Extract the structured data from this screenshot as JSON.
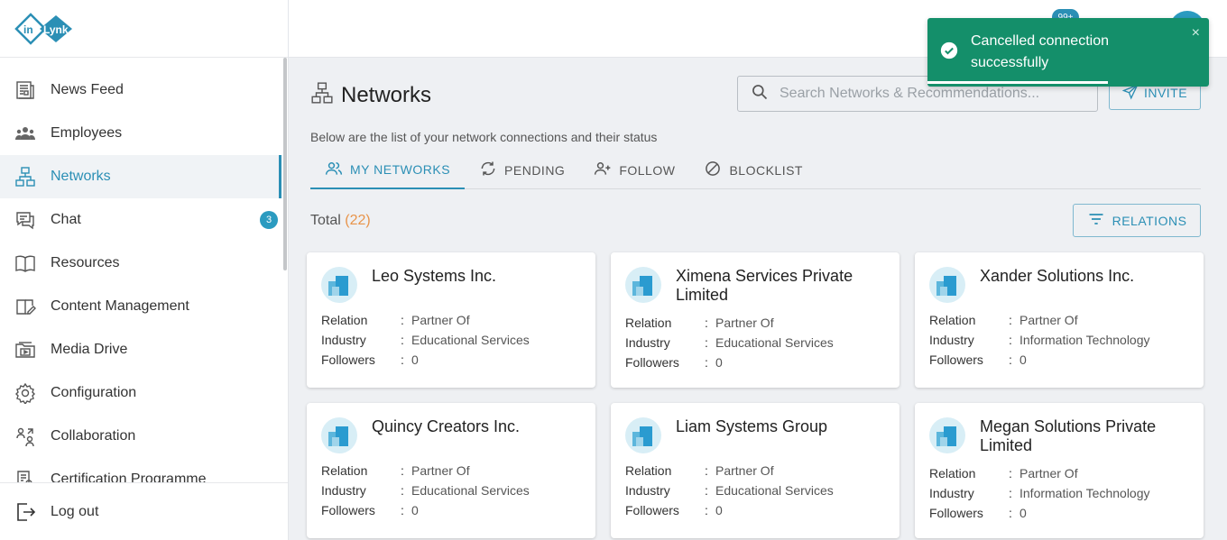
{
  "brand": {
    "logo_part1": "in",
    "logo_part2": "Lynk",
    "colors": {
      "accent": "#2b8fb5",
      "toast": "#148f6a",
      "count": "#e8944a"
    }
  },
  "sidebar": {
    "items": [
      {
        "label": "News Feed",
        "icon": "newspaper-icon"
      },
      {
        "label": "Employees",
        "icon": "people-icon"
      },
      {
        "label": "Networks",
        "icon": "network-icon",
        "active": true
      },
      {
        "label": "Chat",
        "icon": "chat-icon",
        "badge": "3"
      },
      {
        "label": "Resources",
        "icon": "book-icon"
      },
      {
        "label": "Content Management",
        "icon": "edit-book-icon"
      },
      {
        "label": "Media Drive",
        "icon": "folder-media-icon"
      },
      {
        "label": "Configuration",
        "icon": "gear-icon"
      },
      {
        "label": "Collaboration",
        "icon": "collaboration-icon"
      },
      {
        "label": "Certification Programme",
        "icon": "certificate-icon"
      }
    ],
    "logout_label": "Log out"
  },
  "topbar": {
    "notification_badge": "99+"
  },
  "page": {
    "title": "Networks",
    "subtitle": "Below are the list of your network connections and their status",
    "search_placeholder": "Search Networks & Recommendations...",
    "invite_label": "INVITE",
    "tabs": [
      {
        "label": "MY NETWORKS",
        "active": true
      },
      {
        "label": "PENDING"
      },
      {
        "label": "FOLLOW"
      },
      {
        "label": "BLOCKLIST"
      }
    ],
    "total_label": "Total",
    "total_count": "(22)",
    "relations_label": "RELATIONS"
  },
  "card_labels": {
    "relation": "Relation",
    "industry": "Industry",
    "followers": "Followers",
    "sep": ":"
  },
  "cards": [
    {
      "name": "Leo Systems Inc.",
      "relation": "Partner Of",
      "industry": "Educational Services",
      "followers": "0"
    },
    {
      "name": "Ximena Services Private Limited",
      "relation": "Partner Of",
      "industry": "Educational Services",
      "followers": "0"
    },
    {
      "name": "Xander Solutions Inc.",
      "relation": "Partner Of",
      "industry": "Information Technology",
      "followers": "0"
    },
    {
      "name": "Quincy Creators Inc.",
      "relation": "Partner Of",
      "industry": "Educational Services",
      "followers": "0"
    },
    {
      "name": "Liam Systems Group",
      "relation": "Partner Of",
      "industry": "Educational Services",
      "followers": "0"
    },
    {
      "name": "Megan Solutions Private Limited",
      "relation": "Partner Of",
      "industry": "Information Technology",
      "followers": "0"
    }
  ],
  "toast": {
    "message": "Cancelled connection successfully",
    "close": "×"
  }
}
